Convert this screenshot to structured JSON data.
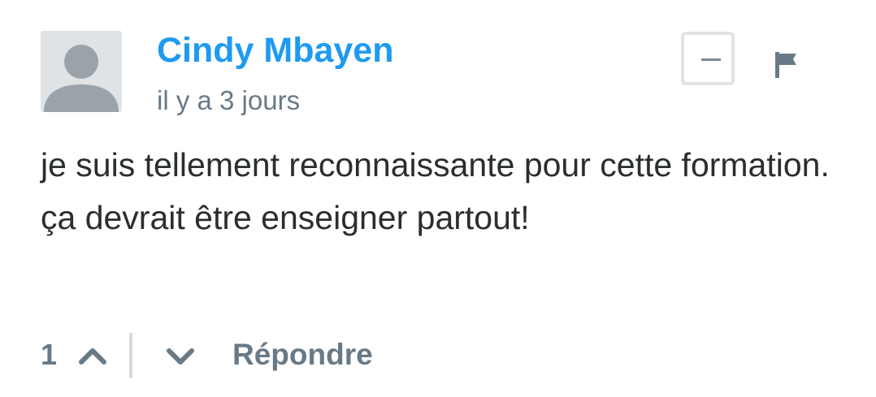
{
  "comment": {
    "author": "Cindy Mbayen",
    "timestamp": "il y a 3 jours",
    "text": "je suis tellement reconnaissante pour cette formation. ça devrait être enseigner partout!",
    "avatar_icon": "default-user-avatar-icon",
    "collapse_icon": "minus-icon",
    "flag_icon": "flag-icon"
  },
  "footer": {
    "vote_count": "1",
    "upvote_icon": "chevron-up-icon",
    "downvote_icon": "chevron-down-icon",
    "reply_label": "Répondre"
  },
  "colors": {
    "author_link": "#1d9bf0",
    "meta_text": "#687a86",
    "body_text": "#2a2e2e",
    "avatar_bg": "#dfe3e6",
    "avatar_figure": "#9aa3aa"
  }
}
